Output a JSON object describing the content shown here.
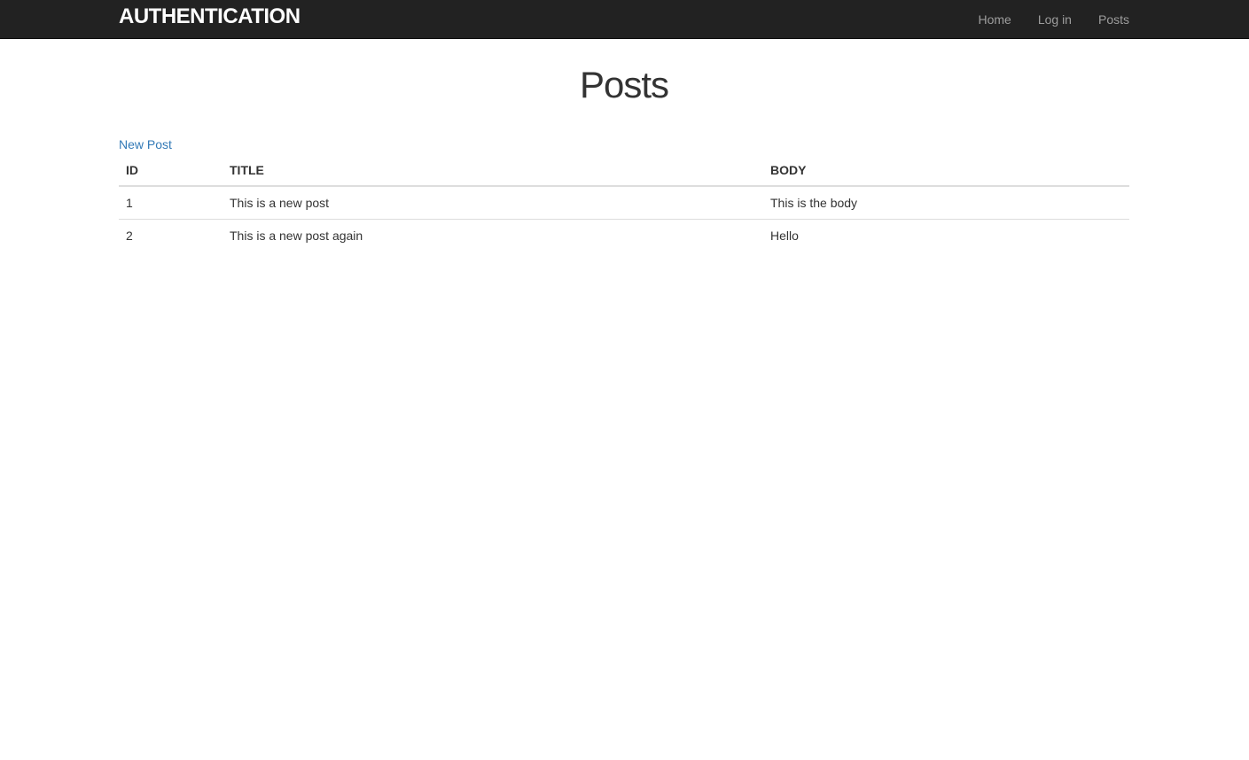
{
  "navbar": {
    "brand": "AUTHENTICATION",
    "links": [
      "Home",
      "Log in",
      "Posts"
    ]
  },
  "main": {
    "title": "Posts",
    "new_post_label": "New Post",
    "table": {
      "headers": [
        "ID",
        "TITLE",
        "BODY"
      ],
      "rows": [
        [
          "1",
          "This is a new post",
          "This is the body"
        ],
        [
          "2",
          "This is a new post again",
          "Hello"
        ]
      ]
    }
  },
  "colors": {
    "navbar_bg": "#222222",
    "link": "#337ab7",
    "nav_link": "#9d9d9d"
  }
}
